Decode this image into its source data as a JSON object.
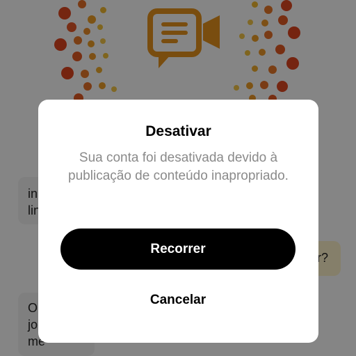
{
  "background": {
    "chat_messages": [
      {
        "text": "in\nlin"
      },
      {
        "text": "r?"
      },
      {
        "text": "O\njo\nme"
      }
    ]
  },
  "dialog": {
    "title": "Desativar",
    "message": "Sua conta foi desativada devido à publicação de conteúdo inapropriado.",
    "primary_label": "Recorrer",
    "secondary_label": "Cancelar"
  },
  "colors": {
    "brand_orange": "#e8951e",
    "dot_red": "#e0451f",
    "dot_gold": "#f0b22a",
    "button_black": "#000000"
  },
  "icons": {
    "logo": "video-chat-logo-icon"
  }
}
